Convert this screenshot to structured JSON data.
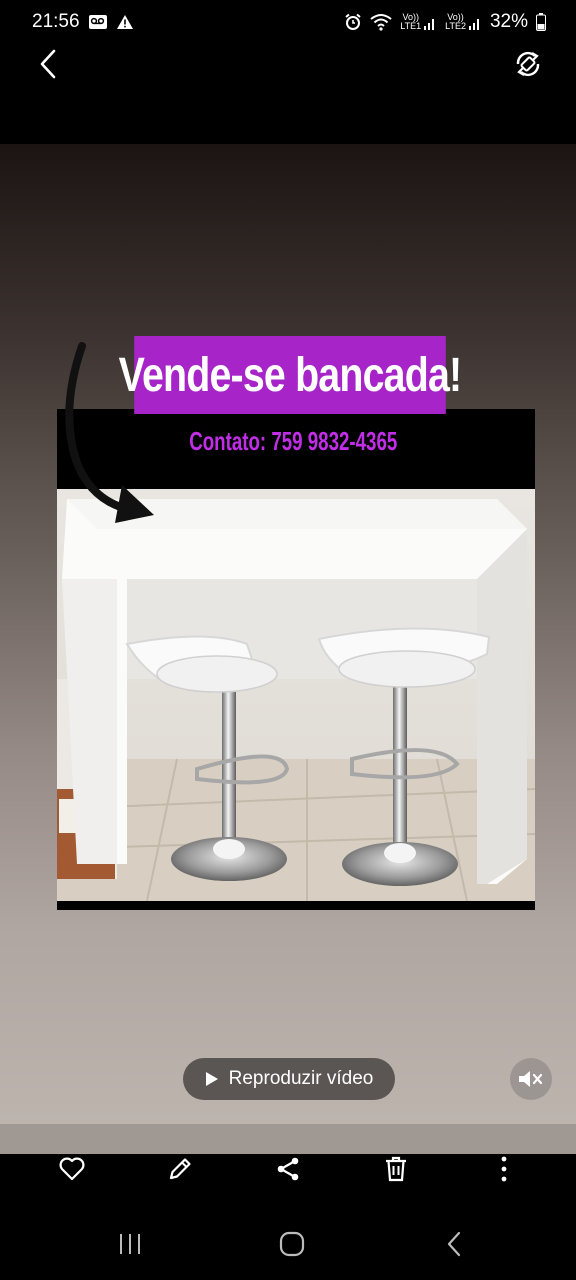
{
  "status_bar": {
    "time": "21:56",
    "sim1": "LTE1",
    "sim2": "LTE2",
    "volte": "Vo))",
    "battery": "32%"
  },
  "post": {
    "headline": "Vende-se bancada!",
    "contact": "Contato: 759 9832-4365"
  },
  "video": {
    "play_label": "Reproduzir vídeo"
  },
  "colors": {
    "headline_bg": "#a624c8",
    "contact_text": "#c22ee8"
  },
  "icons": {
    "back": "chevron-left-icon",
    "rotate": "rotate-screen-icon",
    "play": "play-icon",
    "mute": "speaker-muted-icon",
    "favorite": "heart-icon",
    "edit": "pencil-icon",
    "share": "share-icon",
    "delete": "trash-icon",
    "more": "more-vertical-icon",
    "recents": "recent-apps-icon",
    "home": "home-icon",
    "nav_back": "nav-back-icon"
  }
}
